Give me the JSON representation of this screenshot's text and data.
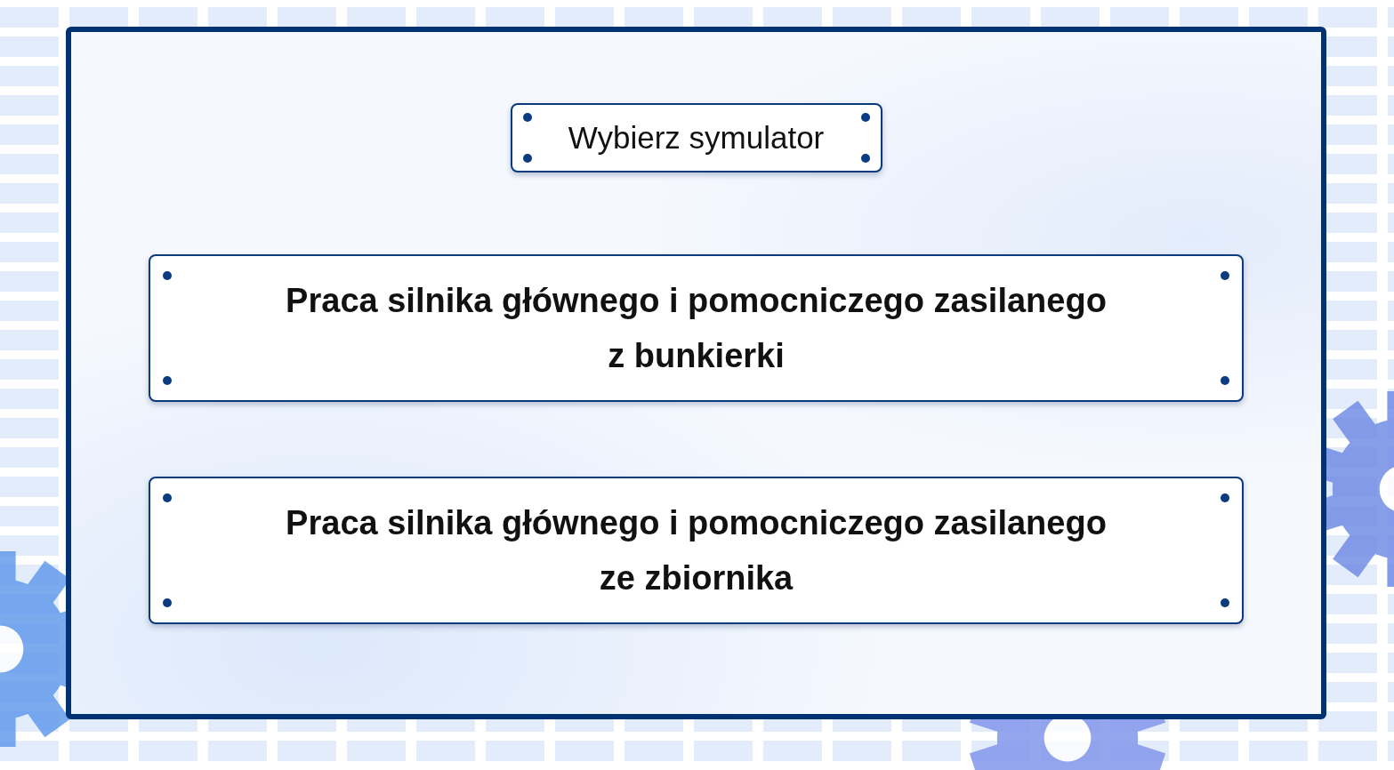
{
  "title": "Wybierz symulator",
  "options": [
    {
      "lines": [
        "Praca silnika głównego i pomocniczego zasilanego",
        "z bunkierki"
      ]
    },
    {
      "lines": [
        "Praca silnika głównego i pomocniczego zasilanego",
        "ze zbiornika"
      ]
    }
  ]
}
